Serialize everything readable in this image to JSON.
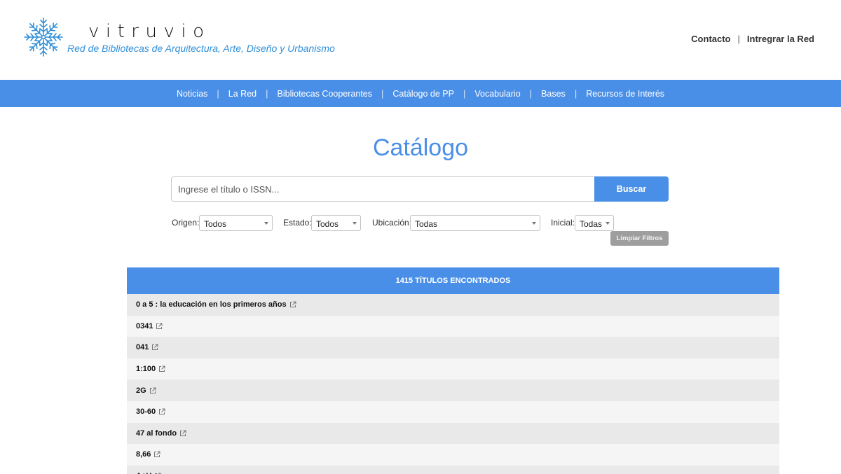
{
  "brand": {
    "name": "vitruvio",
    "subtitle": "Red de Bibliotecas de Arquitectura, Arte, Diseño y Urbanismo",
    "color": "#2f8fd8"
  },
  "top_links": [
    "Contacto",
    "Intregrar la Red"
  ],
  "nav": [
    "Noticias",
    "La Red",
    "Bibliotecas Cooperantes",
    "Catálogo de PP",
    "Vocabulario",
    "Bases",
    "Recursos de Interés"
  ],
  "page_title": "Catálogo",
  "search": {
    "placeholder": "Ingrese el título o ISSN...",
    "value": "",
    "button": "Buscar"
  },
  "filters": {
    "origen": {
      "label": "Origen:",
      "value": "Todos"
    },
    "estado": {
      "label": "Estado:",
      "value": "Todos"
    },
    "ubicacion": {
      "label": "Ubicación:",
      "value": "Todas"
    },
    "inicial": {
      "label": "Inicial:",
      "value": "Todas"
    },
    "clear_button": "Limpiar Filtros"
  },
  "results": {
    "header": "1415 TÍTULOS ENCONTRADOS",
    "items": [
      "0 a 5 : la educación en los primeros años",
      "0341",
      "041",
      "1:100",
      "2G",
      "30-60",
      "47 al fondo",
      "8,66",
      "A+U"
    ]
  },
  "colors": {
    "accent": "#4a8fe7",
    "clear_button": "#9e9e9e"
  },
  "icons": {
    "logo": "snowflake-logo-icon",
    "row_link": "external-link-icon",
    "select": "caret-down-icon"
  }
}
